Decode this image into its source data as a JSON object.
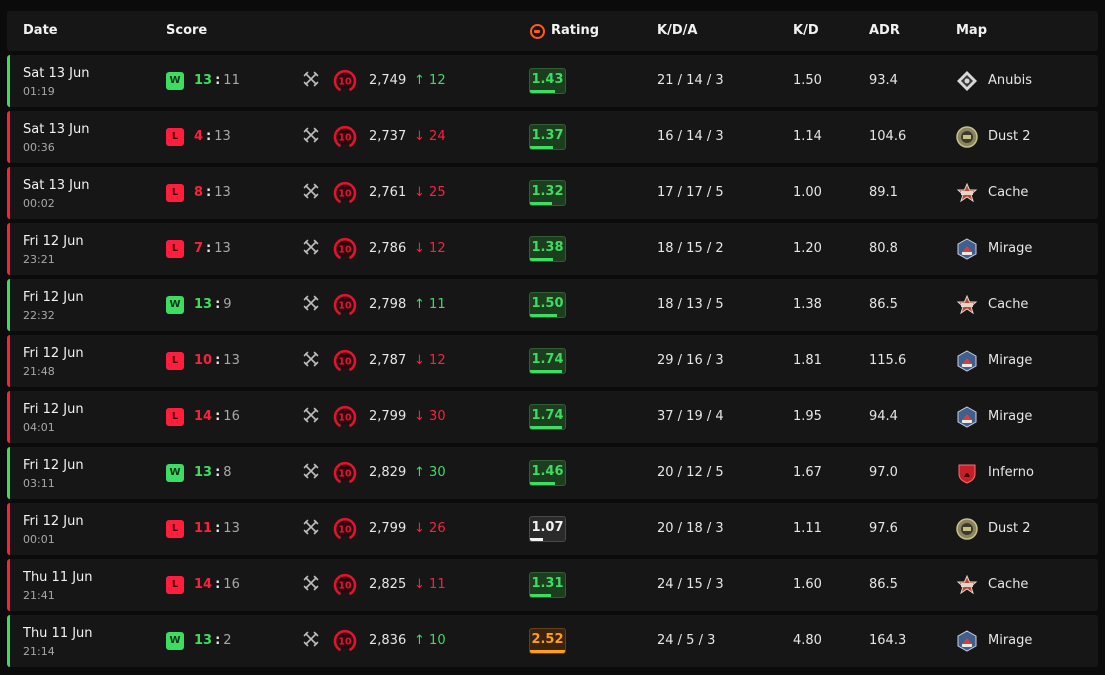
{
  "header": {
    "date": "Date",
    "score": "Score",
    "rating": "Rating",
    "kda": "K/D/A",
    "kd": "K/D",
    "adr": "ADR",
    "map": "Map"
  },
  "colors": {
    "win": "#3ddc62",
    "loss": "#ff1f3d",
    "rating_green": "#3ddc62",
    "rating_white": "#f2f2f2",
    "rating_orange": "#ff9f1a",
    "level_red": "#e8112d"
  },
  "matches": [
    {
      "date": "Sat 13 Jun",
      "time": "01:19",
      "result": "W",
      "own": "13",
      "sep": ":",
      "opp": "11",
      "level": "10",
      "elo": "2,749",
      "delta_dir": "up",
      "delta_arrow": "↑",
      "delta": "12",
      "rating": "1.43",
      "rating_tier": "green",
      "rating_fill": 0.7,
      "kda": "21 / 14 / 3",
      "kd": "1.50",
      "adr": "93.4",
      "map": "Anubis",
      "map_icon": "anubis-map-icon"
    },
    {
      "date": "Sat 13 Jun",
      "time": "00:36",
      "result": "L",
      "own": "4",
      "sep": ":",
      "opp": "13",
      "level": "10",
      "elo": "2,737",
      "delta_dir": "down",
      "delta_arrow": "↓",
      "delta": "24",
      "rating": "1.37",
      "rating_tier": "green",
      "rating_fill": 0.65,
      "kda": "16 / 14 / 3",
      "kd": "1.14",
      "adr": "104.6",
      "map": "Dust 2",
      "map_icon": "dust2-map-icon"
    },
    {
      "date": "Sat 13 Jun",
      "time": "00:02",
      "result": "L",
      "own": "8",
      "sep": ":",
      "opp": "13",
      "level": "10",
      "elo": "2,761",
      "delta_dir": "down",
      "delta_arrow": "↓",
      "delta": "25",
      "rating": "1.32",
      "rating_tier": "green",
      "rating_fill": 0.62,
      "kda": "17 / 17 / 5",
      "kd": "1.00",
      "adr": "89.1",
      "map": "Cache",
      "map_icon": "cache-map-icon"
    },
    {
      "date": "Fri 12 Jun",
      "time": "23:21",
      "result": "L",
      "own": "7",
      "sep": ":",
      "opp": "13",
      "level": "10",
      "elo": "2,786",
      "delta_dir": "down",
      "delta_arrow": "↓",
      "delta": "12",
      "rating": "1.38",
      "rating_tier": "green",
      "rating_fill": 0.66,
      "kda": "18 / 15 / 2",
      "kd": "1.20",
      "adr": "80.8",
      "map": "Mirage",
      "map_icon": "mirage-map-icon"
    },
    {
      "date": "Fri 12 Jun",
      "time": "22:32",
      "result": "W",
      "own": "13",
      "sep": ":",
      "opp": "9",
      "level": "10",
      "elo": "2,798",
      "delta_dir": "up",
      "delta_arrow": "↑",
      "delta": "11",
      "rating": "1.50",
      "rating_tier": "green",
      "rating_fill": 0.78,
      "kda": "18 / 13 / 5",
      "kd": "1.38",
      "adr": "86.5",
      "map": "Cache",
      "map_icon": "cache-map-icon"
    },
    {
      "date": "Fri 12 Jun",
      "time": "21:48",
      "result": "L",
      "own": "10",
      "sep": ":",
      "opp": "13",
      "level": "10",
      "elo": "2,787",
      "delta_dir": "down",
      "delta_arrow": "↓",
      "delta": "12",
      "rating": "1.74",
      "rating_tier": "green",
      "rating_fill": 0.92,
      "kda": "29 / 16 / 3",
      "kd": "1.81",
      "adr": "115.6",
      "map": "Mirage",
      "map_icon": "mirage-map-icon"
    },
    {
      "date": "Fri 12 Jun",
      "time": "04:01",
      "result": "L",
      "own": "14",
      "sep": ":",
      "opp": "16",
      "level": "10",
      "elo": "2,799",
      "delta_dir": "down",
      "delta_arrow": "↓",
      "delta": "30",
      "rating": "1.74",
      "rating_tier": "green",
      "rating_fill": 0.92,
      "kda": "37 / 19 / 4",
      "kd": "1.95",
      "adr": "94.4",
      "map": "Mirage",
      "map_icon": "mirage-map-icon"
    },
    {
      "date": "Fri 12 Jun",
      "time": "03:11",
      "result": "W",
      "own": "13",
      "sep": ":",
      "opp": "8",
      "level": "10",
      "elo": "2,829",
      "delta_dir": "up",
      "delta_arrow": "↑",
      "delta": "30",
      "rating": "1.46",
      "rating_tier": "green",
      "rating_fill": 0.72,
      "kda": "20 / 12 / 5",
      "kd": "1.67",
      "adr": "97.0",
      "map": "Inferno",
      "map_icon": "inferno-map-icon"
    },
    {
      "date": "Fri 12 Jun",
      "time": "00:01",
      "result": "L",
      "own": "11",
      "sep": ":",
      "opp": "13",
      "level": "10",
      "elo": "2,799",
      "delta_dir": "down",
      "delta_arrow": "↓",
      "delta": "26",
      "rating": "1.07",
      "rating_tier": "white",
      "rating_fill": 0.38,
      "kda": "20 / 18 / 3",
      "kd": "1.11",
      "adr": "97.6",
      "map": "Dust 2",
      "map_icon": "dust2-map-icon"
    },
    {
      "date": "Thu 11 Jun",
      "time": "21:41",
      "result": "L",
      "own": "14",
      "sep": ":",
      "opp": "16",
      "level": "10",
      "elo": "2,825",
      "delta_dir": "down",
      "delta_arrow": "↓",
      "delta": "11",
      "rating": "1.31",
      "rating_tier": "green",
      "rating_fill": 0.6,
      "kda": "24 / 15 / 3",
      "kd": "1.60",
      "adr": "86.5",
      "map": "Cache",
      "map_icon": "cache-map-icon"
    },
    {
      "date": "Thu 11 Jun",
      "time": "21:14",
      "result": "W",
      "own": "13",
      "sep": ":",
      "opp": "2",
      "level": "10",
      "elo": "2,836",
      "delta_dir": "up",
      "delta_arrow": "↑",
      "delta": "10",
      "rating": "2.52",
      "rating_tier": "orange",
      "rating_fill": 1.0,
      "kda": "24 / 5 / 3",
      "kd": "4.80",
      "adr": "164.3",
      "map": "Mirage",
      "map_icon": "mirage-map-icon"
    }
  ]
}
